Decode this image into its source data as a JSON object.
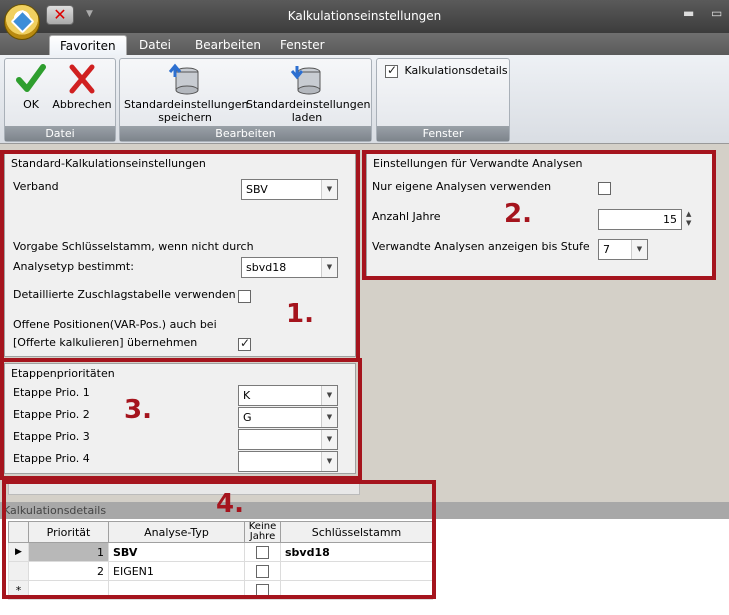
{
  "window": {
    "title": "Kalkulationseinstellungen"
  },
  "ribbon_tabs": [
    "Favoriten",
    "Datei",
    "Bearbeiten",
    "Fenster"
  ],
  "ribbon": {
    "ok_label": "OK",
    "abbrechen_label": "Abbrechen",
    "group_datei": "Datei",
    "save_label_1": "Standardeinstellungen",
    "save_label_2": "speichern",
    "load_label_1": "Standardeinstellungen",
    "load_label_2": "laden",
    "group_bearbeiten": "Bearbeiten",
    "details_checkbox_label": "Kalkulationsdetails",
    "details_checked": true,
    "group_fenster": "Fenster"
  },
  "standard": {
    "title": "Standard-Kalkulationseinstellungen",
    "verband_label": "Verband",
    "verband_value": "SBV",
    "vorgabe_label_1": "Vorgabe Schlüsselstamm, wenn nicht durch",
    "vorgabe_label_2": "Analysetyp bestimmt:",
    "vorgabe_value": "sbvd18",
    "zuschlag_label": "Detaillierte Zuschlagstabelle verwenden",
    "zuschlag_checked": false,
    "offene_label_1": "Offene Positionen(VAR-Pos.) auch bei",
    "offene_label_2": "[Offerte kalkulieren] übernehmen",
    "offene_checked": true
  },
  "verwandte": {
    "title": "Einstellungen für Verwandte Analysen",
    "eigene_label": "Nur eigene Analysen verwenden",
    "eigene_checked": false,
    "jahre_label": "Anzahl Jahre",
    "jahre_value": "15",
    "stufe_label": "Verwandte Analysen anzeigen bis Stufe",
    "stufe_value": "7"
  },
  "etappen": {
    "title": "Etappenprioritäten",
    "items": [
      {
        "label": "Etappe Prio. 1",
        "value": "K"
      },
      {
        "label": "Etappe Prio. 2",
        "value": "G"
      },
      {
        "label": "Etappe Prio. 3",
        "value": ""
      },
      {
        "label": "Etappe Prio. 4",
        "value": ""
      }
    ]
  },
  "details": {
    "title": "Kalkulationsdetails",
    "columns": [
      "Priorität",
      "Analyse-Typ",
      "Keine Jahre",
      "Schlüsselstamm"
    ],
    "rows": [
      {
        "prio": "1",
        "typ": "SBV",
        "keine": false,
        "schluessel": "sbvd18",
        "bold": true,
        "current": true
      },
      {
        "prio": "2",
        "typ": "EIGEN1",
        "keine": false,
        "schluessel": "",
        "bold": false,
        "current": false
      }
    ],
    "new_row_marker": "*"
  },
  "annotations": [
    "1.",
    "2.",
    "3.",
    "4."
  ],
  "colors": {
    "accent_red": "#a5141d"
  }
}
